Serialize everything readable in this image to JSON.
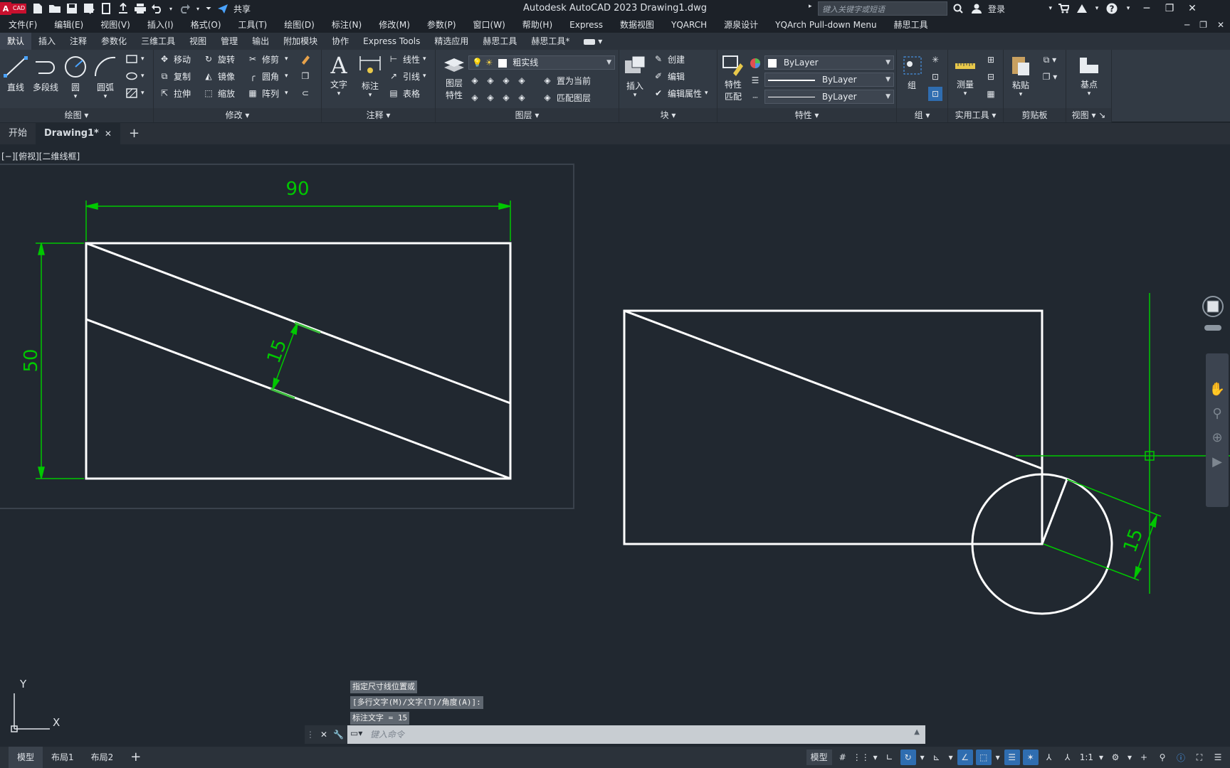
{
  "app": {
    "logo_text": "CAD",
    "title": "Autodesk AutoCAD 2023    Drawing1.dwg",
    "share_label": "共享",
    "search_placeholder": "键入关键字或短语",
    "login_label": "登录"
  },
  "menu": [
    "文件(F)",
    "编辑(E)",
    "视图(V)",
    "插入(I)",
    "格式(O)",
    "工具(T)",
    "绘图(D)",
    "标注(N)",
    "修改(M)",
    "参数(P)",
    "窗口(W)",
    "帮助(H)",
    "Express",
    "数据视图",
    "YQARCH",
    "源泉设计",
    "YQArch Pull-down Menu",
    "赫思工具"
  ],
  "ribbon_tabs": [
    "默认",
    "插入",
    "注释",
    "参数化",
    "三维工具",
    "视图",
    "管理",
    "输出",
    "附加模块",
    "协作",
    "Express Tools",
    "精选应用",
    "赫思工具",
    "赫思工具*"
  ],
  "ribbon": {
    "draw": {
      "label": "绘图",
      "line": "直线",
      "polyline": "多段线",
      "circle": "圆",
      "arc": "圆弧"
    },
    "modify": {
      "label": "修改",
      "move": "移动",
      "rotate": "旋转",
      "trim": "修剪",
      "copy": "复制",
      "mirror": "镜像",
      "fillet": "圆角",
      "stretch": "拉伸",
      "scale": "缩放",
      "array": "阵列"
    },
    "annotation": {
      "label": "注释",
      "text": "文字",
      "dimension": "标注",
      "linear": "线性",
      "leader": "引线",
      "table": "表格"
    },
    "layers": {
      "label": "图层",
      "layer_props_1": "图层",
      "layer_props_2": "特性",
      "layer_combo": "粗实线",
      "set_current": "置为当前",
      "match_layer": "匹配图层"
    },
    "block": {
      "label": "块",
      "insert": "插入",
      "create": "创建",
      "edit": "编辑",
      "edit_attr": "编辑属性"
    },
    "properties": {
      "label": "特性",
      "match_1": "特性",
      "match_2": "匹配",
      "color": "ByLayer",
      "lineweight": "ByLayer",
      "linetype": "ByLayer"
    },
    "groups": {
      "label": "组",
      "group": "组"
    },
    "utilities": {
      "label": "实用工具",
      "measure": "测量"
    },
    "clipboard": {
      "label": "剪贴板",
      "paste": "粘贴"
    },
    "view": {
      "label": "视图",
      "base": "基点"
    }
  },
  "file_tabs": {
    "start": "开始",
    "drawing": "Drawing1*"
  },
  "viewport": {
    "label": "[−][俯视][二维线框]",
    "dim_width": "90",
    "dim_height": "50",
    "dim_offset_left": "15",
    "dim_offset_right": "15",
    "ucs_x": "X",
    "ucs_y": "Y"
  },
  "command": {
    "history": [
      "指定尺寸线位置或",
      "[多行文字(M)/文字(T)/角度(A)]:",
      "标注文字 = 15"
    ],
    "placeholder": "键入命令"
  },
  "status": {
    "layouts": [
      "模型",
      "布局1",
      "布局2"
    ],
    "model_label": "模型",
    "scale": "1:1"
  },
  "colors": {
    "canvas": "#212830",
    "dimension": "#00c800",
    "geometry": "#ffffff",
    "ribbon": "#323a44"
  }
}
